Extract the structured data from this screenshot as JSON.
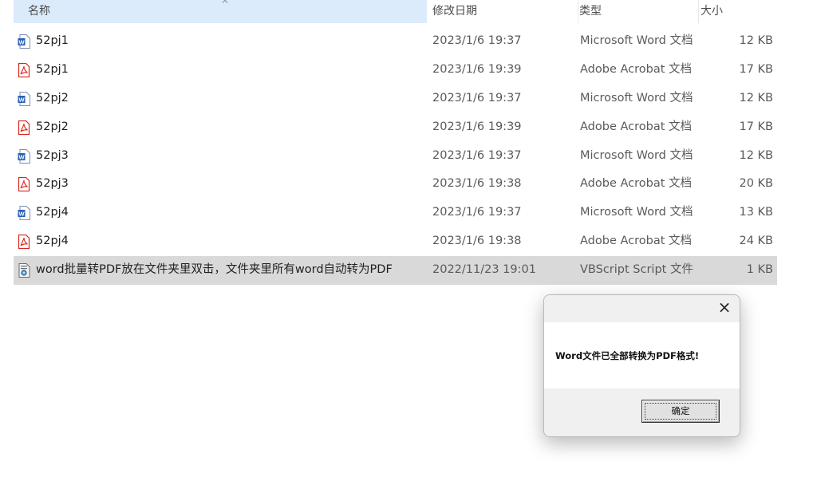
{
  "header": {
    "name": "名称",
    "date_modified": "修改日期",
    "type": "类型",
    "size": "大小"
  },
  "files": [
    {
      "name": "52pj1",
      "date": "2023/1/6 19:37",
      "type": "Microsoft Word 文档",
      "size": "12 KB",
      "icon": "word-doc-icon"
    },
    {
      "name": "52pj1",
      "date": "2023/1/6 19:39",
      "type": "Adobe Acrobat 文档",
      "size": "17 KB",
      "icon": "pdf-icon"
    },
    {
      "name": "52pj2",
      "date": "2023/1/6 19:37",
      "type": "Microsoft Word 文档",
      "size": "12 KB",
      "icon": "word-doc-icon"
    },
    {
      "name": "52pj2",
      "date": "2023/1/6 19:39",
      "type": "Adobe Acrobat 文档",
      "size": "17 KB",
      "icon": "pdf-icon"
    },
    {
      "name": "52pj3",
      "date": "2023/1/6 19:37",
      "type": "Microsoft Word 文档",
      "size": "12 KB",
      "icon": "word-doc-icon"
    },
    {
      "name": "52pj3",
      "date": "2023/1/6 19:38",
      "type": "Adobe Acrobat 文档",
      "size": "20 KB",
      "icon": "pdf-icon"
    },
    {
      "name": "52pj4",
      "date": "2023/1/6 19:37",
      "type": "Microsoft Word 文档",
      "size": "13 KB",
      "icon": "word-doc-icon"
    },
    {
      "name": "52pj4",
      "date": "2023/1/6 19:38",
      "type": "Adobe Acrobat 文档",
      "size": "24 KB",
      "icon": "pdf-icon"
    },
    {
      "name": "word批量转PDF放在文件夹里双击，文件夹里所有word自动转为PDF",
      "date": "2022/11/23 19:01",
      "type": "VBScript Script 文件",
      "size": "1 KB",
      "icon": "vbscript-file-icon"
    }
  ],
  "dialog": {
    "message": "Word文件已全部转换为PDF格式!",
    "ok_label": "确定"
  },
  "colors": {
    "header_highlight": "#dcebfb",
    "selected_row": "#d9d9d9",
    "word_blue": "#2b5fb4",
    "pdf_red": "#d9261c"
  }
}
